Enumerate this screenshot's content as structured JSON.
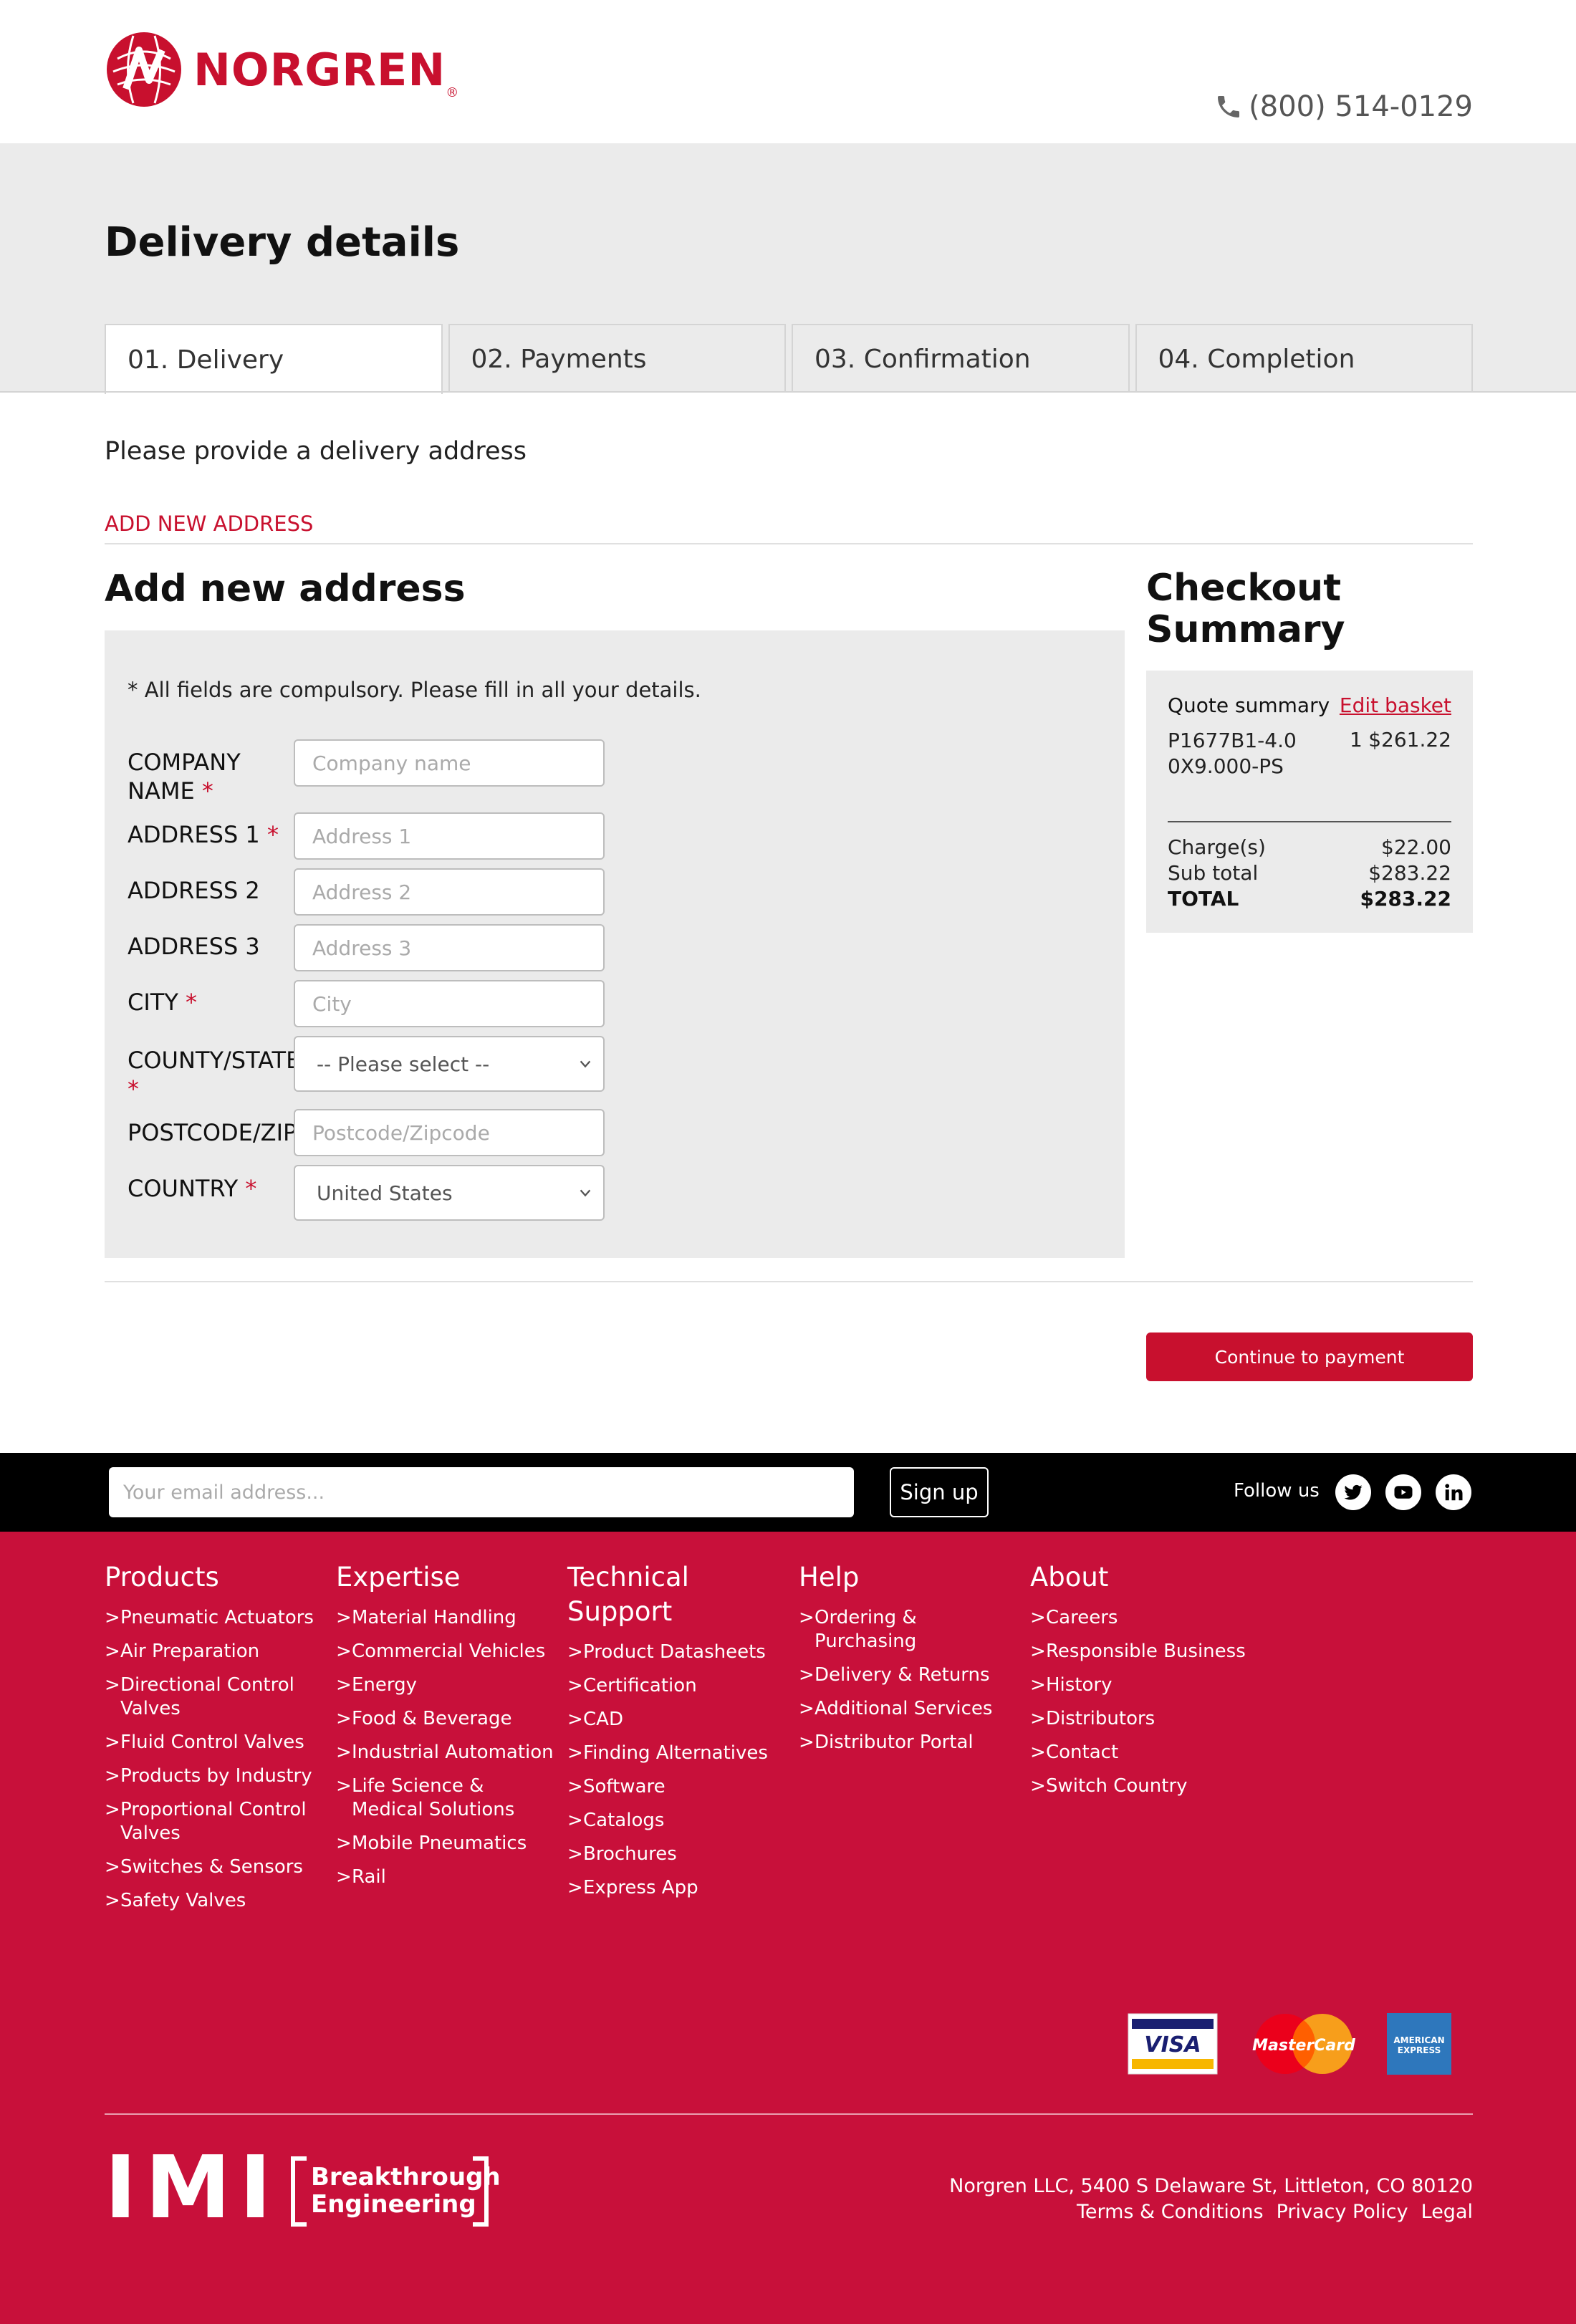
{
  "header": {
    "brand": "NORGREN",
    "brand_mark": "®",
    "phone": "(800) 514-0129"
  },
  "page": {
    "title": "Delivery details",
    "tabs": [
      {
        "label": "01. Delivery",
        "active": true
      },
      {
        "label": "02. Payments",
        "active": false
      },
      {
        "label": "03. Confirmation",
        "active": false
      },
      {
        "label": "04. Completion",
        "active": false
      }
    ],
    "instruction": "Please provide a delivery address",
    "add_address_link": "ADD NEW ADDRESS"
  },
  "form": {
    "title": "Add new address",
    "note": "* All fields are compulsory. Please fill in all your details.",
    "fields": {
      "company": {
        "label_line1": "COMPANY",
        "label_line2": "NAME",
        "required": "*",
        "placeholder": "Company name"
      },
      "address1": {
        "label": "ADDRESS 1",
        "required": "*",
        "placeholder": "Address 1"
      },
      "address2": {
        "label": "ADDRESS 2",
        "placeholder": "Address 2"
      },
      "address3": {
        "label": "ADDRESS 3",
        "placeholder": "Address 3"
      },
      "city": {
        "label": "CITY",
        "required": "*",
        "placeholder": "City"
      },
      "county": {
        "label": "COUNTY/STATE",
        "required": "*",
        "selected": "-- Please select --"
      },
      "postcode": {
        "label": "POSTCODE/ZIP",
        "placeholder": "Postcode/Zipcode"
      },
      "country": {
        "label": "COUNTRY",
        "required": "*",
        "selected": "United States"
      }
    }
  },
  "summary": {
    "title_line1": "Checkout",
    "title_line2": "Summary",
    "heading": "Quote summary",
    "edit_link": "Edit basket",
    "item": {
      "sku": "P1677B1-4.00X9.000-PS",
      "qty": "1",
      "price": "$261.22"
    },
    "rows": [
      {
        "label": "Charge(s)",
        "value": "$22.00"
      },
      {
        "label": "Sub total",
        "value": "$283.22"
      },
      {
        "label": "TOTAL",
        "value": "$283.22"
      }
    ]
  },
  "actions": {
    "continue_label": "Continue to payment"
  },
  "newsletter": {
    "email_placeholder": "Your email address...",
    "signup_label": "Sign up",
    "follow_label": "Follow us",
    "social": [
      "twitter-icon",
      "youtube-icon",
      "linkedin-icon"
    ]
  },
  "footer": {
    "columns": [
      {
        "title_line1": "Products",
        "title_line2": "",
        "links": [
          "Pneumatic Actuators",
          "Air Preparation",
          "Directional Control Valves",
          "Fluid Control Valves",
          "Products by Industry",
          "Proportional Control Valves",
          "Switches & Sensors",
          "Safety Valves"
        ]
      },
      {
        "title_line1": "Expertise",
        "title_line2": "",
        "links": [
          "Material Handling",
          "Commercial Vehicles",
          "Energy",
          "Food & Beverage",
          "Industrial Automation",
          "Life Science & Medical Solutions",
          "Mobile Pneumatics",
          "Rail"
        ]
      },
      {
        "title_line1": "Technical",
        "title_line2": "Support",
        "links": [
          "Product Datasheets",
          "Certification",
          "CAD",
          "Finding Alternatives",
          "Software",
          "Catalogs",
          "Brochures",
          "Express App"
        ]
      },
      {
        "title_line1": "Help",
        "title_line2": "",
        "links": [
          "Ordering & Purchasing",
          "Delivery & Returns",
          "Additional Services",
          "Distributor Portal"
        ]
      },
      {
        "title_line1": "About",
        "title_line2": "",
        "links": [
          "Careers",
          "Responsible Business",
          "History",
          "Distributors",
          "Contact",
          "Switch Country"
        ]
      }
    ],
    "cards": {
      "visa": "VISA",
      "mastercard": "MasterCard",
      "amex_line1": "AMERICAN",
      "amex_line2": "EXPRESS"
    },
    "imi": "IMI",
    "tagline_line1": "Breakthrough",
    "tagline_line2": "Engineering",
    "address": "Norgren LLC, 5400 S Delaware St, Littleton, CO 80120",
    "legal_links": [
      "Terms & Conditions",
      "Privacy Policy",
      "Legal"
    ]
  },
  "colors": {
    "brand_red": "#c8102e",
    "footer_red": "#c8103a",
    "grey_band": "#ebebeb"
  }
}
